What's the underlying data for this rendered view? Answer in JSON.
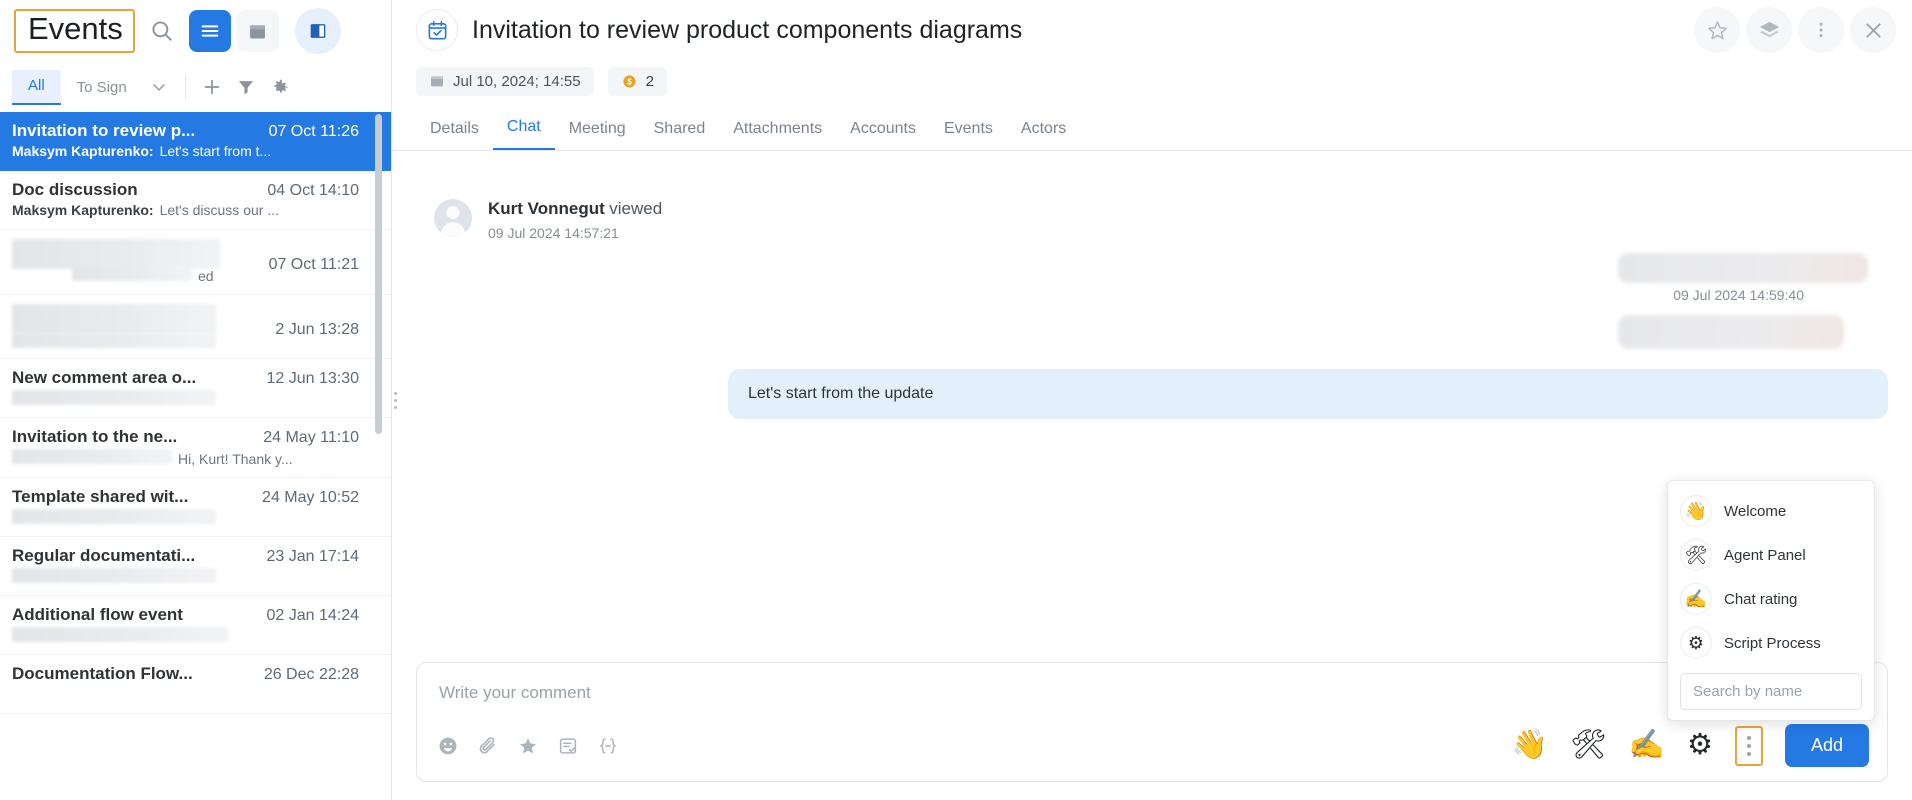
{
  "sidebar": {
    "title": "Events",
    "toolbar": {
      "search_icon": "search-icon",
      "list_view_icon": "list-view-icon",
      "calendar_view_icon": "calendar-view-icon",
      "panel_toggle_icon": "panel-toggle-icon"
    },
    "filters": {
      "all": "All",
      "to_sign": "To Sign",
      "chevron_icon": "chevron-down-icon",
      "add_icon": "plus-icon",
      "filter_icon": "funnel-icon",
      "settings_icon": "gear-icon"
    },
    "items": [
      {
        "title": "Invitation to review p...",
        "date": "07 Oct 11:26",
        "who": "Maksym Kapturenko:",
        "preview": "Let's start from t...",
        "selected": true,
        "redacted_title": false,
        "redacted_who": false
      },
      {
        "title": "Doc discussion",
        "date": "04 Oct 14:10",
        "who": "Maksym Kapturenko:",
        "preview": "Let's discuss our ...",
        "selected": false,
        "redacted_title": false,
        "redacted_who": false
      },
      {
        "title": "",
        "date": "07 Oct 11:21",
        "who": "",
        "preview": "ed",
        "selected": false,
        "redacted_title": true,
        "redacted_who": true
      },
      {
        "title": "",
        "date": "2 Jun 13:28",
        "who": "",
        "preview": "",
        "selected": false,
        "redacted_title": true,
        "redacted_who": true
      },
      {
        "title": "New comment area o...",
        "date": "12 Jun 13:30",
        "who": "",
        "preview": "",
        "selected": false,
        "redacted_title": false,
        "redacted_who": true
      },
      {
        "title": "Invitation to the ne...",
        "date": "24 May 11:10",
        "who": "",
        "preview": "Hi, Kurt! Thank y...",
        "selected": false,
        "redacted_title": false,
        "redacted_who": true
      },
      {
        "title": "Template shared wit...",
        "date": "24 May 10:52",
        "who": "",
        "preview": "",
        "selected": false,
        "redacted_title": false,
        "redacted_who": true
      },
      {
        "title": "Regular documentati...",
        "date": "23 Jan 17:14",
        "who": "",
        "preview": "",
        "selected": false,
        "redacted_title": false,
        "redacted_who": true
      },
      {
        "title": "Additional flow event",
        "date": "02 Jan 14:24",
        "who": "",
        "preview": "",
        "selected": false,
        "redacted_title": false,
        "redacted_who": true
      },
      {
        "title": "Documentation Flow...",
        "date": "26 Dec 22:28",
        "who": "",
        "preview": "",
        "selected": false,
        "redacted_title": false,
        "redacted_who": true
      }
    ]
  },
  "header": {
    "title": "Invitation to review product components diagrams",
    "type_icon": "calendar-check-icon",
    "actions": {
      "favorite": "star-icon",
      "layers": "layers-icon",
      "more": "kebab-menu-icon",
      "close": "close-icon"
    }
  },
  "meta": {
    "date_icon": "calendar-icon",
    "date": "Jul 10, 2024; 14:55",
    "coin_icon": "coin-icon",
    "coin_count": "2"
  },
  "tabs": [
    {
      "label": "Details",
      "active": false
    },
    {
      "label": "Chat",
      "active": true
    },
    {
      "label": "Meeting",
      "active": false
    },
    {
      "label": "Shared",
      "active": false
    },
    {
      "label": "Attachments",
      "active": false
    },
    {
      "label": "Accounts",
      "active": false
    },
    {
      "label": "Events",
      "active": false
    },
    {
      "label": "Actors",
      "active": false
    }
  ],
  "chat": {
    "event": {
      "avatar": "user-avatar",
      "name": "Kurt Vonnegut",
      "verb": "viewed",
      "time": "09 Jul 2024 14:57:21"
    },
    "redacted_message_time": "09 Jul 2024 14:59:40",
    "bubble_text": "Let's start from the update"
  },
  "composer": {
    "placeholder": "Write your comment",
    "tools": [
      {
        "name": "emoji-icon"
      },
      {
        "name": "attachment-icon"
      },
      {
        "name": "star-icon"
      },
      {
        "name": "task-icon"
      },
      {
        "name": "code-snippet-icon"
      }
    ],
    "quick_actions": [
      {
        "name": "wave-emoji-icon",
        "glyph": "👋"
      },
      {
        "name": "tools-emoji-icon",
        "glyph": "🛠"
      },
      {
        "name": "writing-hand-emoji-icon",
        "glyph": "✍"
      },
      {
        "name": "gears-emoji-icon",
        "glyph": "⚙"
      }
    ],
    "more_button": "more-actions-kebab",
    "add_label": "Add"
  },
  "popup": {
    "items": [
      {
        "label": "Welcome",
        "icon": "wave-emoji-icon",
        "glyph": "👋"
      },
      {
        "label": "Agent Panel",
        "icon": "tools-emoji-icon",
        "glyph": "🛠"
      },
      {
        "label": "Chat rating",
        "icon": "writing-hand-emoji-icon",
        "glyph": "✍"
      },
      {
        "label": "Script Process",
        "icon": "gears-emoji-icon",
        "glyph": "⚙"
      }
    ],
    "search_placeholder": "Search by name"
  },
  "colors": {
    "accent": "#2579e3",
    "highlight_border": "#e8a33d",
    "bubble": "#e4effc"
  }
}
